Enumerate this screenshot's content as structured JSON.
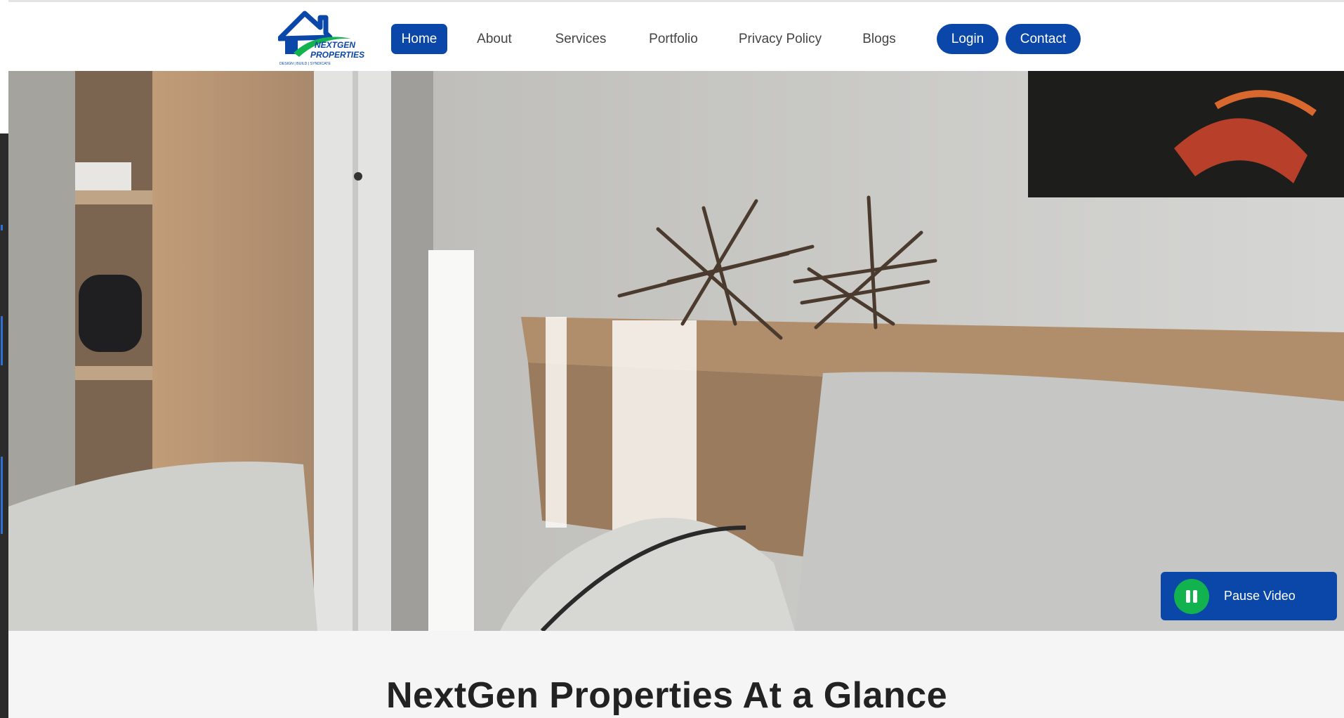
{
  "brand": {
    "logo_line1": "NEXTGEN",
    "logo_line2": "PROPERTIES",
    "logo_tagline": "DESIGN | BUILD | SYNDICATE",
    "primary_color": "#0a47a8",
    "accent_color": "#12b24f"
  },
  "nav": {
    "items": [
      {
        "label": "Home",
        "active": true
      },
      {
        "label": "About",
        "active": false
      },
      {
        "label": "Services",
        "active": false
      },
      {
        "label": "Portfolio",
        "active": false
      },
      {
        "label": "Privacy Policy",
        "active": false
      },
      {
        "label": "Blogs",
        "active": false
      }
    ],
    "login_label": "Login",
    "contact_label": "Contact"
  },
  "hero": {
    "pause_label": "Pause Video",
    "pause_icon": "pause-icon"
  },
  "section": {
    "title": "NextGen Properties At a Glance"
  }
}
